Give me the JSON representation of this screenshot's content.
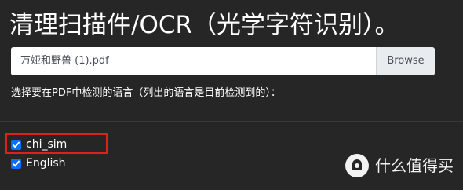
{
  "header": {
    "title": "清理扫描件/OCR（光学字符识别）。"
  },
  "file_input": {
    "file_name": "万娅和野兽 (1).pdf",
    "browse_label": "Browse"
  },
  "languages": {
    "instruction": "选择要在PDF中检测的语言（列出的语言是目前检测到的）：",
    "items": [
      {
        "label": "chi_sim",
        "checked": true
      },
      {
        "label": "English",
        "checked": true
      }
    ]
  },
  "watermark": {
    "text": "什么值得买"
  },
  "colors": {
    "background": "#262626",
    "checkbox": "#0d6efd",
    "highlight": "#e02020"
  }
}
